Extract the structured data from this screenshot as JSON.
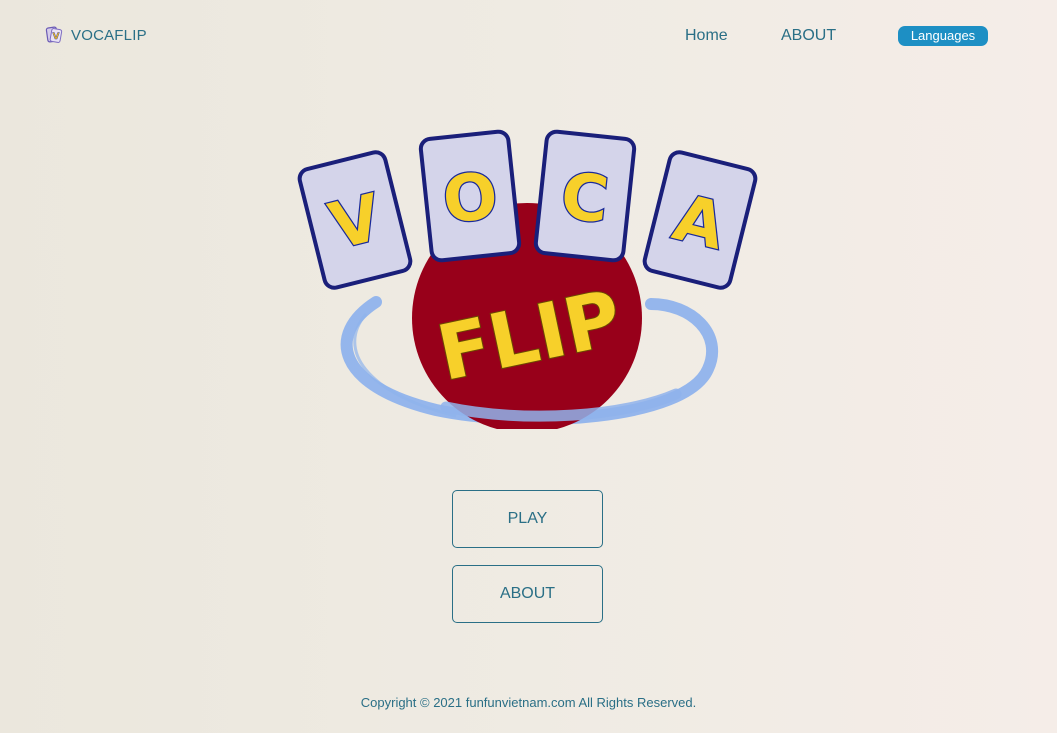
{
  "nav": {
    "brand_icon": "card-logo-icon",
    "brand": "VOCAFLIP",
    "home": "Home",
    "about": "ABOUT",
    "languages": "Languages"
  },
  "logo": {
    "cards": [
      "V",
      "O",
      "C",
      "A"
    ],
    "word": "FLIP",
    "colors": {
      "card_fill": "#d4d4ea",
      "card_border": "#1a1f7a",
      "letter": "#f7d02a",
      "letter_outline": "#1a2a9a",
      "circle": "#98001a",
      "swirl": "#8fb3ec"
    }
  },
  "menu": {
    "play": "PLAY",
    "about": "ABOUT"
  },
  "footer": {
    "copyright": "Copyright © 2021 funfunvietnam.com All Rights Reserved."
  },
  "theme": {
    "primary_text": "#2a6f86",
    "button_accent": "#1d8fc4"
  }
}
